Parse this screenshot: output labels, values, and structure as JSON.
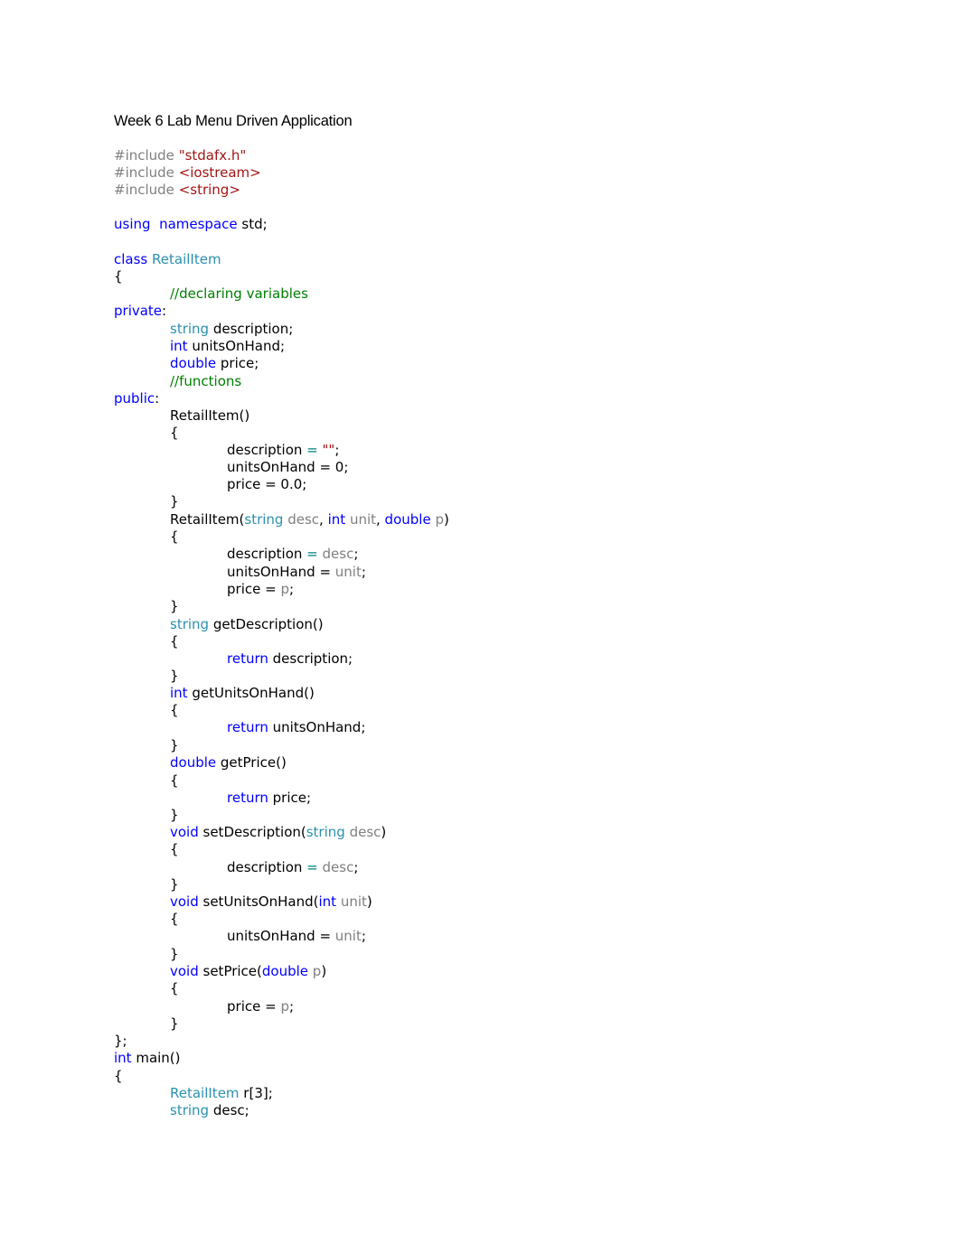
{
  "document": {
    "title": "Week 6 Lab Menu Driven Application",
    "colors": {
      "keyword": "#0000ff",
      "type": "#2b91af",
      "preprocessor": "#808080",
      "string": "#a31515",
      "comment": "#008000",
      "parameter": "#808080",
      "operator": "#008080",
      "text": "#000000"
    },
    "code_lines": [
      {
        "indent": 0,
        "tokens": [
          [
            "pp",
            "#include "
          ],
          [
            "str",
            "\"stdafx.h\""
          ]
        ]
      },
      {
        "indent": 0,
        "tokens": [
          [
            "pp",
            "#include "
          ],
          [
            "str",
            "<iostream>"
          ]
        ]
      },
      {
        "indent": 0,
        "tokens": [
          [
            "pp",
            "#include "
          ],
          [
            "str",
            "<string>"
          ]
        ]
      },
      {
        "indent": 0,
        "tokens": []
      },
      {
        "indent": 0,
        "tokens": [
          [
            "kw",
            "using"
          ],
          [
            "",
            "  "
          ],
          [
            "kw",
            "namespace"
          ],
          [
            "",
            " std;"
          ]
        ]
      },
      {
        "indent": 0,
        "tokens": []
      },
      {
        "indent": 0,
        "tokens": [
          [
            "kw",
            "class"
          ],
          [
            "",
            " "
          ],
          [
            "ty",
            "RetailItem"
          ]
        ]
      },
      {
        "indent": 0,
        "tokens": [
          [
            "",
            "{"
          ]
        ]
      },
      {
        "indent": 1,
        "tokens": [
          [
            "cm",
            "//declaring variables"
          ]
        ]
      },
      {
        "indent": 0,
        "tokens": [
          [
            "kw",
            "private"
          ],
          [
            "",
            ":"
          ]
        ]
      },
      {
        "indent": 1,
        "tokens": [
          [
            "ty",
            "string"
          ],
          [
            "",
            " description;"
          ]
        ]
      },
      {
        "indent": 1,
        "tokens": [
          [
            "kw",
            "int"
          ],
          [
            "",
            " unitsOnHand;"
          ]
        ]
      },
      {
        "indent": 1,
        "tokens": [
          [
            "kw",
            "double"
          ],
          [
            "",
            " price;"
          ]
        ]
      },
      {
        "indent": 1,
        "tokens": [
          [
            "cm",
            "//functions"
          ]
        ]
      },
      {
        "indent": 0,
        "tokens": [
          [
            "kw",
            "public"
          ],
          [
            "",
            ":"
          ]
        ]
      },
      {
        "indent": 1,
        "tokens": [
          [
            "",
            "RetailItem()"
          ]
        ]
      },
      {
        "indent": 1,
        "tokens": [
          [
            "",
            "{"
          ]
        ]
      },
      {
        "indent": 2,
        "tokens": [
          [
            "",
            "description "
          ],
          [
            "op",
            "="
          ],
          [
            "",
            " "
          ],
          [
            "str",
            "\"\""
          ],
          [
            "",
            ";"
          ]
        ]
      },
      {
        "indent": 2,
        "tokens": [
          [
            "",
            "unitsOnHand = 0;"
          ]
        ]
      },
      {
        "indent": 2,
        "tokens": [
          [
            "",
            "price = 0.0;"
          ]
        ]
      },
      {
        "indent": 1,
        "tokens": [
          [
            "",
            "}"
          ]
        ]
      },
      {
        "indent": 1,
        "tokens": [
          [
            "",
            "RetailItem("
          ],
          [
            "ty",
            "string"
          ],
          [
            "",
            " "
          ],
          [
            "par",
            "desc"
          ],
          [
            "",
            ", "
          ],
          [
            "kw",
            "int"
          ],
          [
            "",
            " "
          ],
          [
            "par",
            "unit"
          ],
          [
            "",
            ", "
          ],
          [
            "kw",
            "double"
          ],
          [
            "",
            " "
          ],
          [
            "par",
            "p"
          ],
          [
            "",
            ")"
          ]
        ]
      },
      {
        "indent": 1,
        "tokens": [
          [
            "",
            "{"
          ]
        ]
      },
      {
        "indent": 2,
        "tokens": [
          [
            "",
            "description "
          ],
          [
            "op",
            "="
          ],
          [
            "",
            " "
          ],
          [
            "par",
            "desc"
          ],
          [
            "",
            ";"
          ]
        ]
      },
      {
        "indent": 2,
        "tokens": [
          [
            "",
            "unitsOnHand = "
          ],
          [
            "par",
            "unit"
          ],
          [
            "",
            ";"
          ]
        ]
      },
      {
        "indent": 2,
        "tokens": [
          [
            "",
            "price = "
          ],
          [
            "par",
            "p"
          ],
          [
            "",
            ";"
          ]
        ]
      },
      {
        "indent": 1,
        "tokens": [
          [
            "",
            "}"
          ]
        ]
      },
      {
        "indent": 1,
        "tokens": [
          [
            "ty",
            "string"
          ],
          [
            "",
            " getDescription()"
          ]
        ]
      },
      {
        "indent": 1,
        "tokens": [
          [
            "",
            "{"
          ]
        ]
      },
      {
        "indent": 2,
        "tokens": [
          [
            "kw",
            "return"
          ],
          [
            "",
            " description;"
          ]
        ]
      },
      {
        "indent": 1,
        "tokens": [
          [
            "",
            "}"
          ]
        ]
      },
      {
        "indent": 1,
        "tokens": [
          [
            "kw",
            "int"
          ],
          [
            "",
            " getUnitsOnHand()"
          ]
        ]
      },
      {
        "indent": 1,
        "tokens": [
          [
            "",
            "{"
          ]
        ]
      },
      {
        "indent": 2,
        "tokens": [
          [
            "kw",
            "return"
          ],
          [
            "",
            " unitsOnHand;"
          ]
        ]
      },
      {
        "indent": 1,
        "tokens": [
          [
            "",
            "}"
          ]
        ]
      },
      {
        "indent": 1,
        "tokens": [
          [
            "kw",
            "double"
          ],
          [
            "",
            " getPrice()"
          ]
        ]
      },
      {
        "indent": 1,
        "tokens": [
          [
            "",
            "{"
          ]
        ]
      },
      {
        "indent": 2,
        "tokens": [
          [
            "kw",
            "return"
          ],
          [
            "",
            " price;"
          ]
        ]
      },
      {
        "indent": 1,
        "tokens": [
          [
            "",
            "}"
          ]
        ]
      },
      {
        "indent": 1,
        "tokens": [
          [
            "kw",
            "void"
          ],
          [
            "",
            " setDescription("
          ],
          [
            "ty",
            "string"
          ],
          [
            "",
            " "
          ],
          [
            "par",
            "desc"
          ],
          [
            "",
            ")"
          ]
        ]
      },
      {
        "indent": 1,
        "tokens": [
          [
            "",
            "{"
          ]
        ]
      },
      {
        "indent": 2,
        "tokens": [
          [
            "",
            "description "
          ],
          [
            "op",
            "="
          ],
          [
            "",
            " "
          ],
          [
            "par",
            "desc"
          ],
          [
            "",
            ";"
          ]
        ]
      },
      {
        "indent": 1,
        "tokens": [
          [
            "",
            "}"
          ]
        ]
      },
      {
        "indent": 1,
        "tokens": [
          [
            "kw",
            "void"
          ],
          [
            "",
            " setUnitsOnHand("
          ],
          [
            "kw",
            "int"
          ],
          [
            "",
            " "
          ],
          [
            "par",
            "unit"
          ],
          [
            "",
            ")"
          ]
        ]
      },
      {
        "indent": 1,
        "tokens": [
          [
            "",
            "{"
          ]
        ]
      },
      {
        "indent": 2,
        "tokens": [
          [
            "",
            "unitsOnHand = "
          ],
          [
            "par",
            "unit"
          ],
          [
            "",
            ";"
          ]
        ]
      },
      {
        "indent": 1,
        "tokens": [
          [
            "",
            "}"
          ]
        ]
      },
      {
        "indent": 1,
        "tokens": [
          [
            "kw",
            "void"
          ],
          [
            "",
            " setPrice("
          ],
          [
            "kw",
            "double"
          ],
          [
            "",
            " "
          ],
          [
            "par",
            "p"
          ],
          [
            "",
            ")"
          ]
        ]
      },
      {
        "indent": 1,
        "tokens": [
          [
            "",
            "{"
          ]
        ]
      },
      {
        "indent": 2,
        "tokens": [
          [
            "",
            "price = "
          ],
          [
            "par",
            "p"
          ],
          [
            "",
            ";"
          ]
        ]
      },
      {
        "indent": 1,
        "tokens": [
          [
            "",
            "}"
          ]
        ]
      },
      {
        "indent": 0,
        "tokens": [
          [
            "",
            "};"
          ]
        ]
      },
      {
        "indent": 0,
        "tokens": [
          [
            "kw",
            "int"
          ],
          [
            "",
            " main()"
          ]
        ]
      },
      {
        "indent": 0,
        "tokens": [
          [
            "",
            "{"
          ]
        ]
      },
      {
        "indent": 1,
        "tokens": [
          [
            "ty",
            "RetailItem"
          ],
          [
            "",
            " r[3];"
          ]
        ]
      },
      {
        "indent": 1,
        "tokens": [
          [
            "ty",
            "string"
          ],
          [
            "",
            " desc;"
          ]
        ]
      }
    ]
  }
}
